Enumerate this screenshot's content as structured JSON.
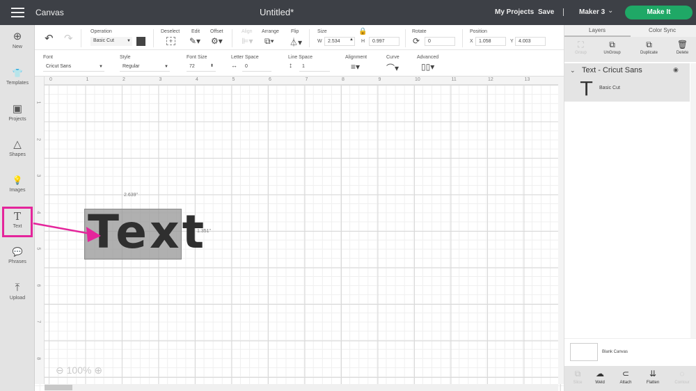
{
  "topbar": {
    "app_name": "Canvas",
    "document_title": "Untitled*",
    "my_projects": "My Projects",
    "save": "Save",
    "machine": "Maker 3",
    "make_it": "Make It",
    "accent_color": "#1fa866"
  },
  "sidebar": {
    "items": [
      {
        "label": "New",
        "icon": "⊕"
      },
      {
        "label": "Templates",
        "icon": "👕"
      },
      {
        "label": "Projects",
        "icon": "▣"
      },
      {
        "label": "Shapes",
        "icon": "△"
      },
      {
        "label": "Images",
        "icon": "💡"
      },
      {
        "label": "Text",
        "icon": "T"
      },
      {
        "label": "Phrases",
        "icon": "💬"
      },
      {
        "label": "Upload",
        "icon": "⤒"
      }
    ],
    "highlight_color": "#e4259b"
  },
  "toolbar": {
    "undo": "↶",
    "redo": "↷",
    "operation_label": "Operation",
    "operation_value": "Basic Cut",
    "deselect_label": "Deselect",
    "edit_label": "Edit",
    "offset_label": "Offset",
    "align_label": "Align",
    "arrange_label": "Arrange",
    "flip_label": "Flip",
    "size_label": "Size",
    "w_label": "W",
    "w_value": "2.534",
    "h_label": "H",
    "h_value": "0.997",
    "rotate_label": "Rotate",
    "rotate_value": "0",
    "position_label": "Position",
    "x_label": "X",
    "x_value": "1.058",
    "y_label": "Y",
    "y_value": "4.003"
  },
  "textbar": {
    "font_label": "Font",
    "font_value": "Cricut Sans",
    "style_label": "Style",
    "style_value": "Regular",
    "font_size_label": "Font Size",
    "font_size_value": "72",
    "letter_space_label": "Letter Space",
    "letter_space_value": "0",
    "line_space_label": "Line Space",
    "line_space_value": "1",
    "alignment_label": "Alignment",
    "curve_label": "Curve",
    "advanced_label": "Advanced"
  },
  "canvas": {
    "ruler_h": [
      "0",
      "1",
      "2",
      "3",
      "4",
      "5",
      "6",
      "7",
      "8",
      "9",
      "10",
      "11",
      "12",
      "13"
    ],
    "ruler_v": [
      "1",
      "2",
      "3",
      "4",
      "5",
      "6",
      "7",
      "8"
    ],
    "text_object": "Text",
    "width_dim": "2.639\"",
    "height_dim": "1.351\"",
    "zoom_level": "100%"
  },
  "layers_panel": {
    "tabs": [
      "Layers",
      "Color Sync"
    ],
    "actions": [
      {
        "label": "Group",
        "icon": "⛶",
        "enabled": false
      },
      {
        "label": "UnGroup",
        "icon": "⧉",
        "enabled": true
      },
      {
        "label": "Duplicate",
        "icon": "⧉",
        "enabled": true
      },
      {
        "label": "Delete",
        "icon": "🗑",
        "enabled": true
      }
    ],
    "layer_group_title": "Text - Cricut Sans",
    "layer_item_icon": "T",
    "layer_item_label": "Basic Cut",
    "blank_canvas_label": "Blank Canvas",
    "bottom_actions": [
      {
        "label": "Slice",
        "icon": "⧉",
        "enabled": false
      },
      {
        "label": "Weld",
        "icon": "☁",
        "enabled": true
      },
      {
        "label": "Attach",
        "icon": "⊂",
        "enabled": true
      },
      {
        "label": "Flatten",
        "icon": "⇊",
        "enabled": true
      },
      {
        "label": "Contour",
        "icon": "◌",
        "enabled": false
      }
    ]
  }
}
